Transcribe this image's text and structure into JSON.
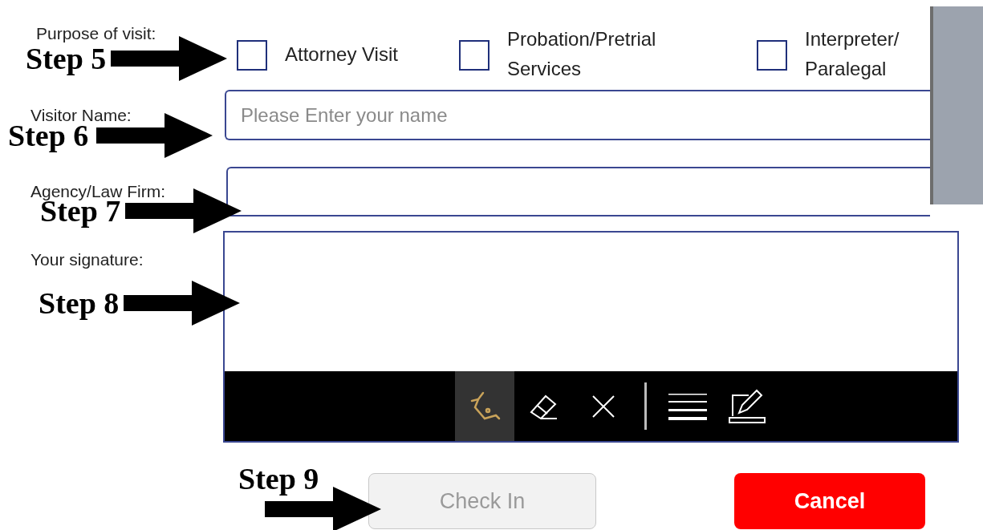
{
  "purpose": {
    "label": "Purpose of visit:",
    "options": [
      {
        "label": "Attorney Visit",
        "checked": false
      },
      {
        "label": "Probation/Pretrial Services",
        "checked": false
      },
      {
        "label": "Interpreter/ Paralegal",
        "checked": false
      }
    ]
  },
  "fields": [
    {
      "label": "Visitor Name:",
      "placeholder": "Please Enter your name"
    },
    {
      "label": "Agency/Law Firm:"
    }
  ],
  "signature": {
    "label": "Your signature:",
    "tools": [
      {
        "kind": "pen",
        "selected": true
      },
      {
        "kind": "eraser",
        "selected": false
      },
      {
        "kind": "clear",
        "selected": false
      }
    ],
    "options": [
      {
        "kind": "thickness",
        "selected": false
      },
      {
        "kind": "edit",
        "selected": false
      }
    ]
  },
  "buttons": [
    {
      "label": "Check In",
      "kind": "secondary",
      "disabled": true
    },
    {
      "label": "Cancel",
      "kind": "danger",
      "disabled": false
    }
  ],
  "annotations": [
    {
      "text": "Step 5"
    },
    {
      "text": "Step 6"
    },
    {
      "text": "Step 7"
    },
    {
      "text": "Step 8"
    },
    {
      "text": "Step 9"
    }
  ]
}
